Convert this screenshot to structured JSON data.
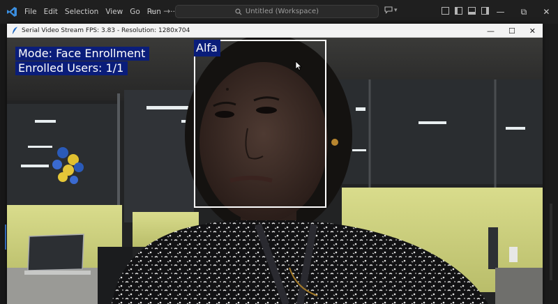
{
  "vscode": {
    "menu": [
      "File",
      "Edit",
      "Selection",
      "View",
      "Go",
      "Run",
      "···"
    ],
    "search_text": "Untitled (Workspace)",
    "accent_color": "#3b7bd6"
  },
  "video_window": {
    "title": "Serial Video Stream FPS: 3.83 - Resolution: 1280x704",
    "controls": {
      "minimize": "—",
      "maximize": "☐",
      "close": "✕"
    }
  },
  "overlay": {
    "mode": "Mode: Face Enrollment",
    "enrolled": "Enrolled Users: 1/1",
    "face_name": "Alfa",
    "label_bg_color": "#0a1d7a",
    "box_color": "#ffffff"
  },
  "icons": {
    "vscode_logo": "vscode-logo-icon",
    "search": "search-icon",
    "copilot": "copilot-icon",
    "window_feather": "feather-icon",
    "cursor": "mouse-cursor-icon"
  }
}
